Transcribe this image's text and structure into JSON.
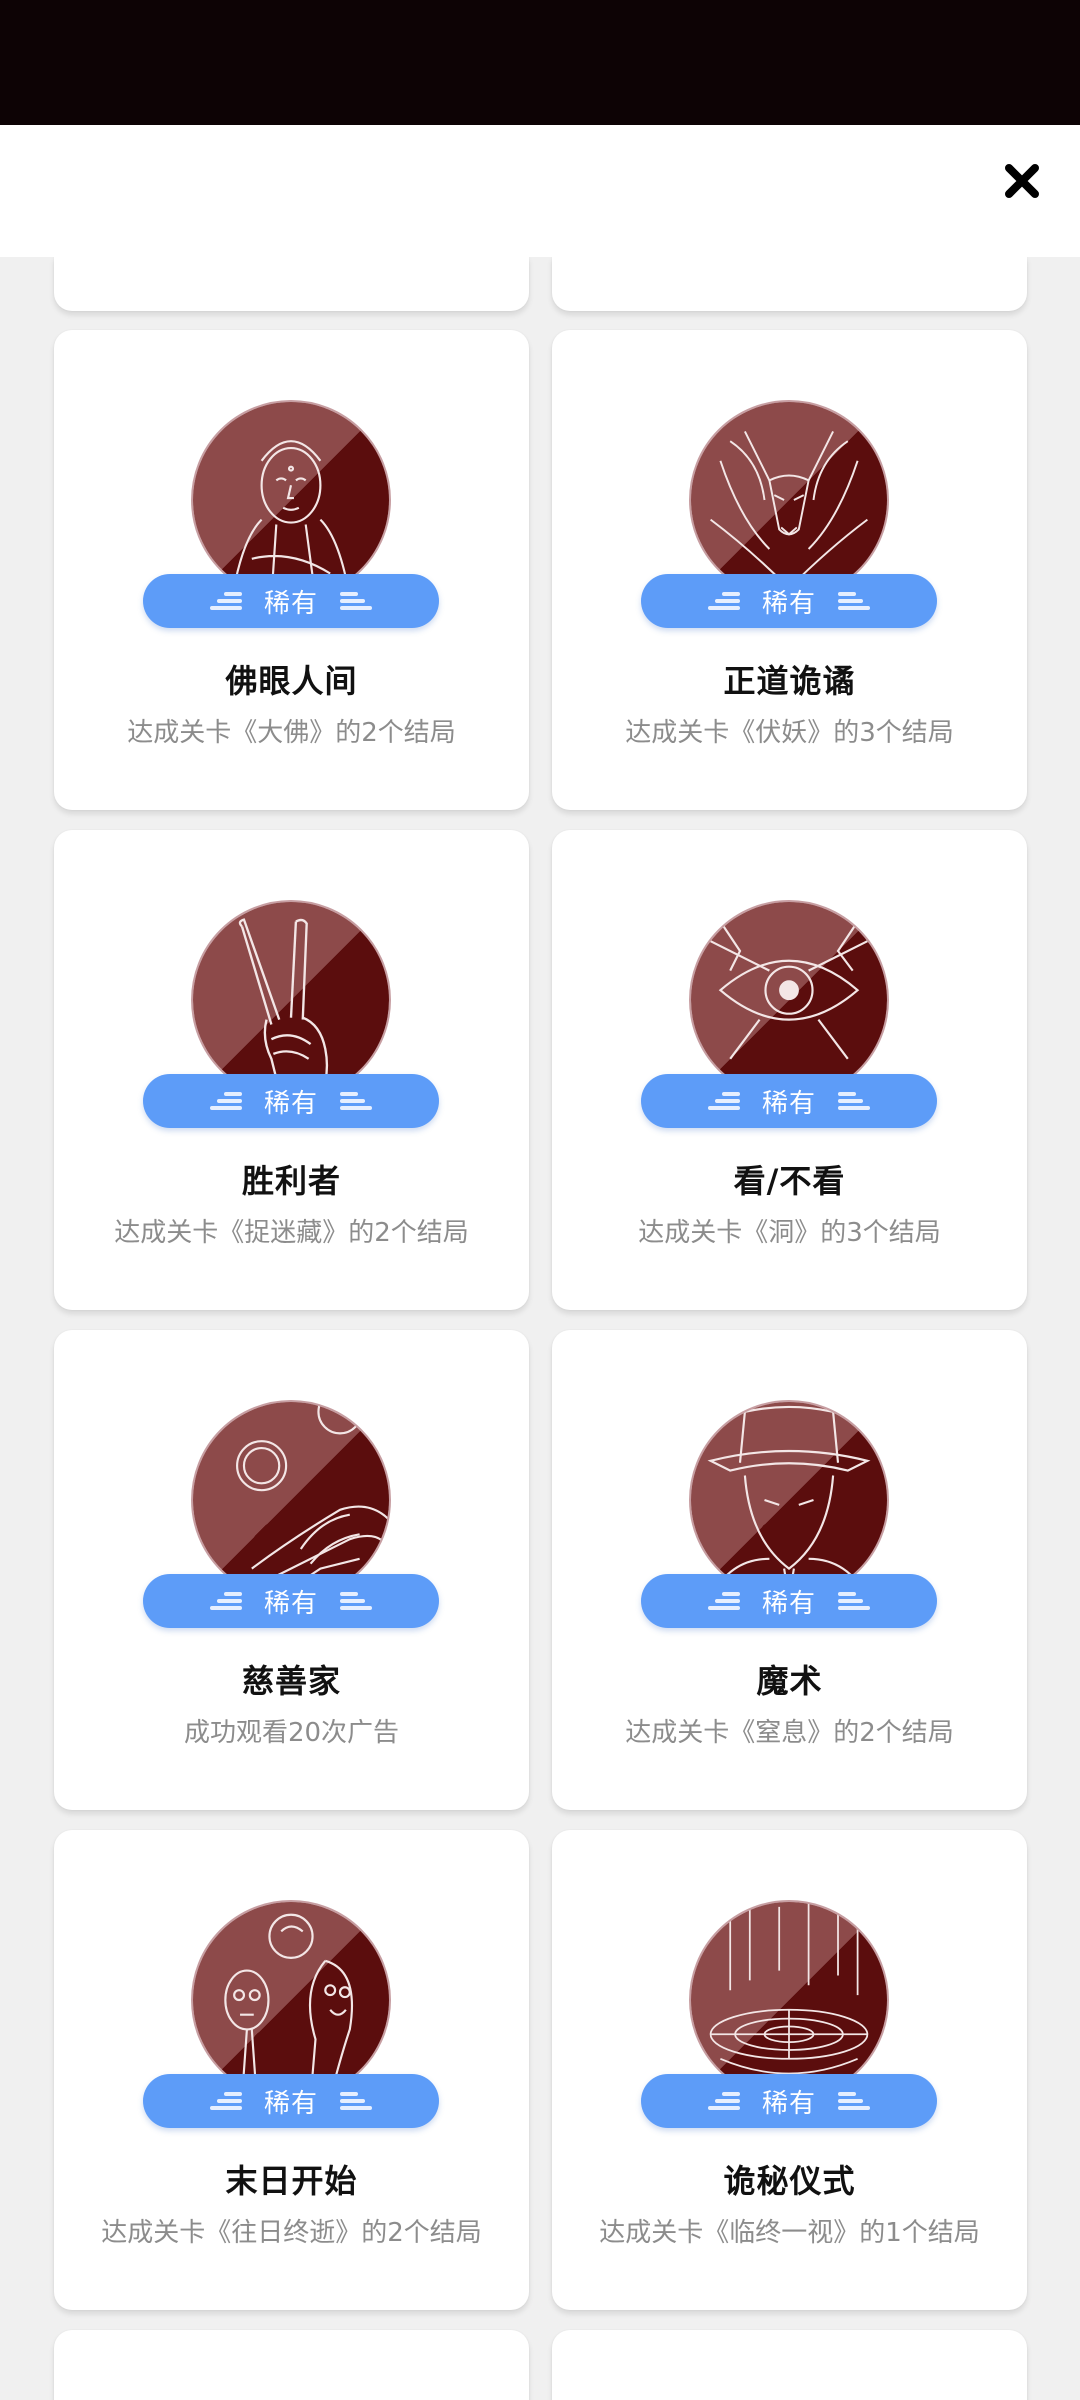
{
  "header": {
    "close_icon": "close-icon"
  },
  "achievements": [
    {
      "title": "佛眼人间",
      "badge": "稀有",
      "description": "达成关卡《大佛》的2个结局",
      "art": "buddha"
    },
    {
      "title": "正道诡谲",
      "badge": "稀有",
      "description": "达成关卡《伏妖》的3个结局",
      "art": "fox"
    },
    {
      "title": "胜利者",
      "badge": "稀有",
      "description": "达成关卡《捉迷藏》的2个结局",
      "art": "victory-hand"
    },
    {
      "title": "看/不看",
      "badge": "稀有",
      "description": "达成关卡《洞》的3个结局",
      "art": "eye"
    },
    {
      "title": "慈善家",
      "badge": "稀有",
      "description": "成功观看20次广告",
      "art": "coins-hand"
    },
    {
      "title": "魔术",
      "badge": "稀有",
      "description": "达成关卡《窒息》的2个结局",
      "art": "magician"
    },
    {
      "title": "末日开始",
      "badge": "稀有",
      "description": "达成关卡《往日终逝》的2个结局",
      "art": "ghouls"
    },
    {
      "title": "诡秘仪式",
      "badge": "稀有",
      "description": "达成关卡《临终一视》的1个结局",
      "art": "ritual"
    }
  ],
  "colors": {
    "badge": "#5d9cf8",
    "avatar_dark": "#5b0d0d",
    "avatar_light": "#8d4a4a",
    "status_bar": "#0d0305"
  }
}
